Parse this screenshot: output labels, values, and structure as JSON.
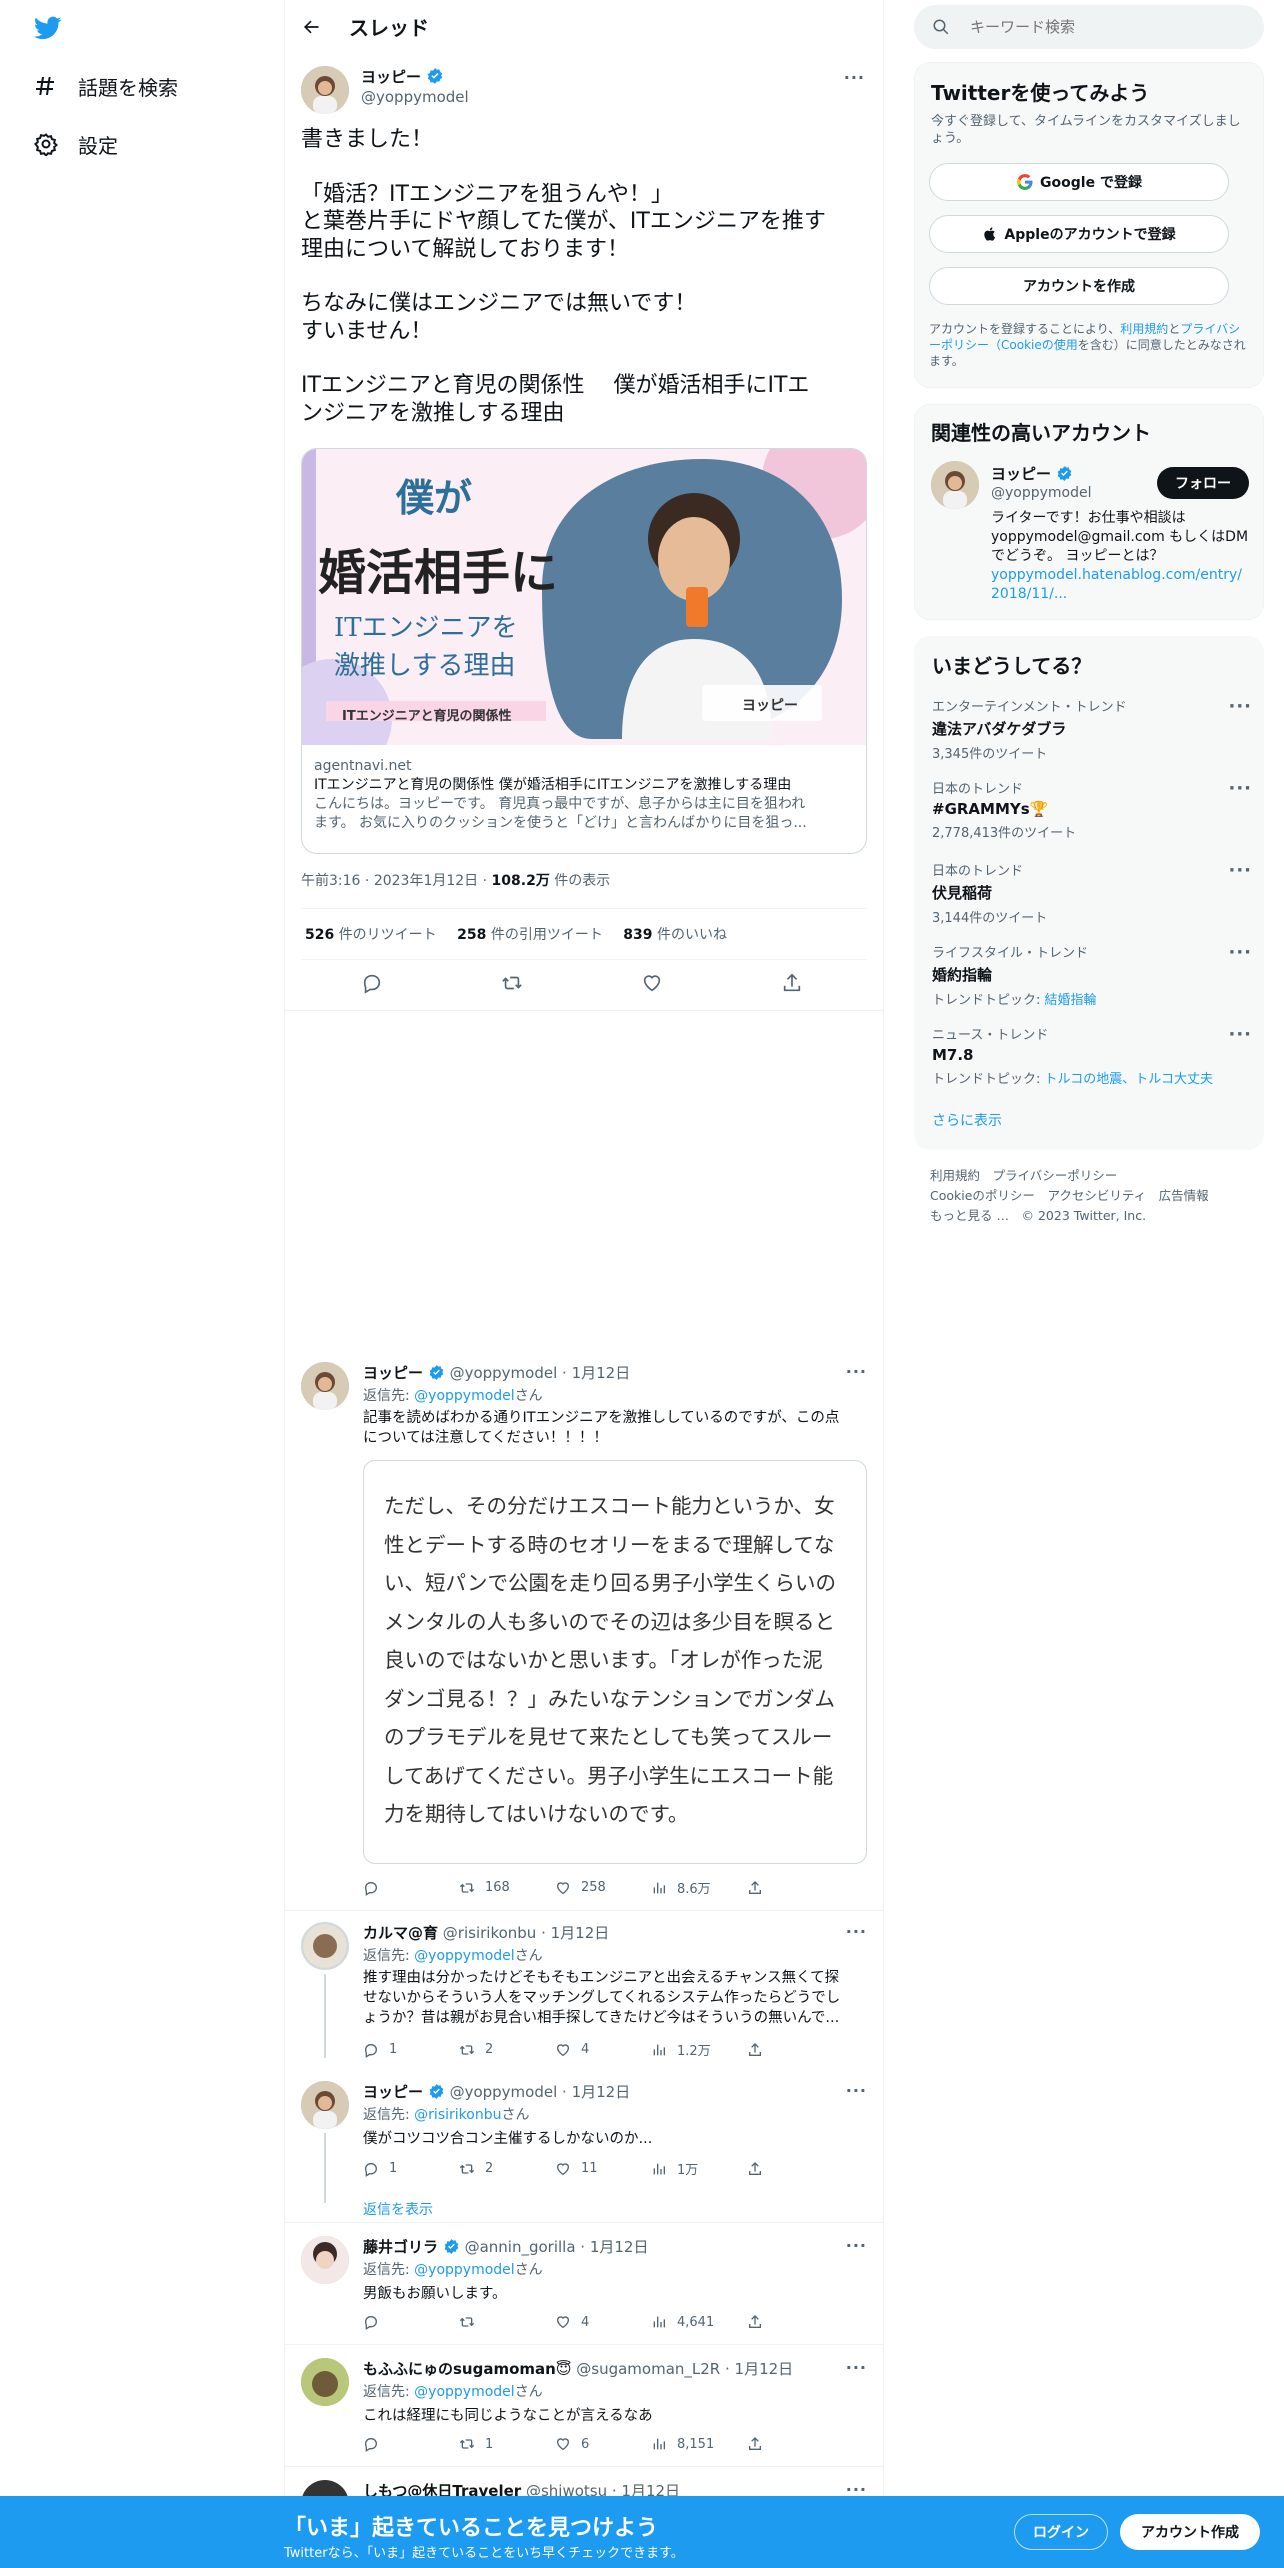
{
  "nav": {
    "explore": "話題を検索",
    "settings": "設定"
  },
  "header": {
    "title": "スレッド"
  },
  "tweet": {
    "name": "ヨッピー",
    "handle": "@yoppymodel",
    "text": [
      "書きました！",
      "",
      "「婚活？ITエンジニアを狙うんや！」",
      "と葉巻片手にドヤ顔してた僕が、ITエンジニアを推す",
      "理由について解説しております！",
      "",
      "ちなみに僕はエンジニアでは無いです！",
      "すいません！",
      "",
      "ITエンジニアと育児の関係性　 僕が婚活相手にITエ",
      "ンジニアを激推しする理由"
    ],
    "card": {
      "domain": "agentnavi.net",
      "title": "ITエンジニアと育児の関係性 僕が婚活相手にITエンジニアを激推しする理由",
      "desc1": "こんにちは。ヨッピーです。 育児真っ最中ですが、息子からは主に目を狙われ",
      "desc2": "ます。 お気に入りのクッションを使うと「どけ」と言わんばかりに目を狙っ...",
      "img_t1": "僕が",
      "img_t2": "婚活相手に",
      "img_t3": "ITエンジニアを",
      "img_t4": "激推しする理由",
      "img_t5": "ITエンジニアと育児の関係性",
      "img_name": "ヨッピー"
    },
    "meta": {
      "time": "午前3:16",
      "date": "2023年1月12日",
      "views": "108.2万",
      "views_label": "件の表示"
    },
    "stats": {
      "rt": "526",
      "rt_label": "件のリツイート",
      "quote": "258",
      "quote_label": "件の引用ツイート",
      "likes": "839",
      "likes_label": "件のいいね"
    }
  },
  "replies": [
    {
      "name": "ヨッピー",
      "handle": "@yoppymodel",
      "date": "1月12日",
      "to_label": "返信先: ",
      "to": "@yoppymodel",
      "to_suffix": "さん",
      "text1": "記事を読めばわかる通りITエンジニアを激推ししているのですが、この点",
      "text2": "については注意してください！！！！",
      "quote": [
        "ただし、その分だけエスコート能力というか、女",
        "性とデートする時のセオリーをまるで理解してな",
        "い、短パンで公園を走り回る男子小学生くらいの",
        "メンタルの人も多いのでその辺は多少目を瞑ると",
        "良いのではないかと思います。「オレが作った泥",
        "ダンゴ見る！？」みたいなテンションでガンダム",
        "のプラモデルを見せて来たとしても笑ってスルー",
        "してあげてください。男子小学生にエスコート能",
        "力を期待してはいけないのです。"
      ],
      "rt": "168",
      "likes": "258",
      "views": "8.6万"
    },
    {
      "name": "カルマ@育",
      "handle": "@risirikonbu",
      "date": "1月12日",
      "to_label": "返信先: ",
      "to": "@yoppymodel",
      "to_suffix": "さん",
      "text1": "推す理由は分かったけどそもそもエンジニアと出会えるチャンス無くて探",
      "text2": "せないからそういう人をマッチングしてくれるシステム作ったらどうでし",
      "text3": "ょうか？昔は親がお見合い相手探してきたけど今はそういうの無いんで...",
      "replies": "1",
      "rt": "2",
      "likes": "4",
      "views": "1.2万"
    },
    {
      "name": "ヨッピー",
      "handle": "@yoppymodel",
      "date": "1月12日",
      "to_label": "返信先: ",
      "to": "@risirikonbu",
      "to_suffix": "さん",
      "text1": "僕がコツコツ合コン主催するしかないのか...",
      "replies": "1",
      "rt": "2",
      "likes": "11",
      "views": "1万",
      "show_replies": "返信を表示"
    },
    {
      "name": "藤井ゴリラ",
      "handle": "@annin_gorilla",
      "date": "1月12日",
      "to_label": "返信先: ",
      "to": "@yoppymodel",
      "to_suffix": "さん",
      "text1": "男飯もお願いします。",
      "likes": "4",
      "views": "4,641"
    },
    {
      "name": "もふふにゅのsugamoman😇",
      "handle": "@sugamoman_L2R",
      "date": "1月12日",
      "to_label": "返信先: ",
      "to": "@yoppymodel",
      "to_suffix": "さん",
      "text1": "これは経理にも同じようなことが言えるなあ",
      "rt": "1",
      "likes": "6",
      "views": "8,151"
    },
    {
      "name": "しもつ@休日Traveler",
      "handle": "@shiwotsu",
      "date": "1月12日"
    }
  ],
  "search": {
    "placeholder": "キーワード検索"
  },
  "signup": {
    "title": "Twitterを使ってみよう",
    "sub": "今すぐ登録して、タイムラインをカスタマイズしましょう。",
    "google": "Google で登録",
    "apple": "Appleのアカウントで登録",
    "create": "アカウントを作成",
    "terms1": "アカウントを登録することにより、",
    "terms_link1": "利用規約",
    "terms2": "と",
    "terms_link2": "プライバシーポリシー（Cookieの使用",
    "terms3": "を含む）に同意したとみなされます。"
  },
  "related": {
    "title": "関連性の高いアカウント",
    "name": "ヨッピー",
    "handle": "@yoppymodel",
    "follow": "フォロー",
    "bio1": "ライターです！お仕事や相談は",
    "bio2": "yoppymodel@gmail.com もしくはDM",
    "bio3": "でどうぞ。 ヨッピーとは？",
    "bio_link": "yoppymodel.hatenablog.com/entry/",
    "bio_link2": "2018/11/..."
  },
  "trends": {
    "title": "いまどうしてる？",
    "items": [
      {
        "cat": "エンターテインメント・トレンド",
        "name": "違法アバダケダブラ",
        "count": "3,345件のツイート"
      },
      {
        "cat": "日本のトレンド",
        "name": "#GRAMMYs🏆",
        "count": "2,778,413件のツイート"
      },
      {
        "cat": "日本のトレンド",
        "name": "伏見稲荷",
        "count": "3,144件のツイート"
      },
      {
        "cat": "ライフスタイル・トレンド",
        "name": "婚約指輪",
        "count_label": "トレンドトピック: ",
        "count_link": "結婚指輪"
      },
      {
        "cat": "ニュース・トレンド",
        "name": "M7.8",
        "count_label": "トレンドトピック: ",
        "count_link": "トルコの地震、トルコ大丈夫"
      }
    ],
    "more": "さらに表示"
  },
  "footer": {
    "l1": "利用規約",
    "l2": "プライバシーポリシー",
    "l3": "Cookieのポリシー",
    "l4": "アクセシビリティ",
    "l5": "広告情報",
    "l6": "もっと見る …",
    "copy": "© 2023 Twitter, Inc."
  },
  "bottom": {
    "title": "「いま」起きていることを見つけよう",
    "sub": "Twitterなら、「いま」起きていることをいち早くチェックできます。",
    "login": "ログイン",
    "signup": "アカウント作成"
  },
  "colors": {
    "accent": "#1d9bf0"
  }
}
